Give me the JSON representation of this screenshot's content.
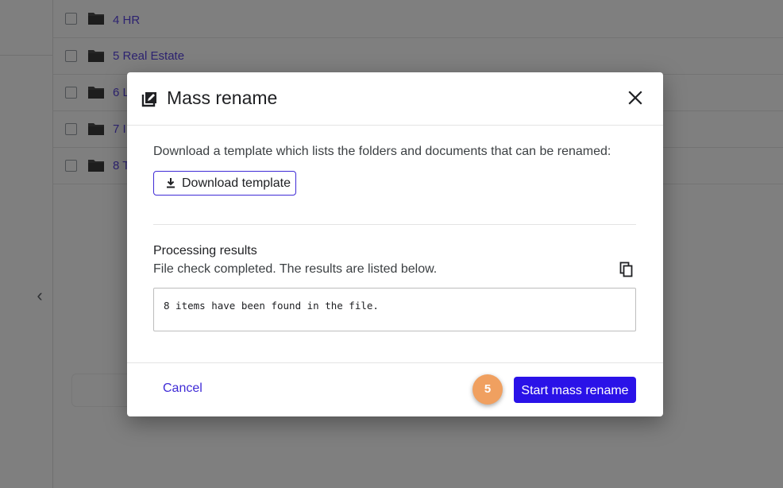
{
  "background": {
    "folders": [
      {
        "name": "4 HR"
      },
      {
        "name": "5 Real Estate"
      },
      {
        "name": "6 L"
      },
      {
        "name": "7 I"
      },
      {
        "name": "8 T"
      }
    ],
    "collapse_glyph": "‹"
  },
  "dialog": {
    "title": "Mass rename",
    "title_icon": "edit-note-icon",
    "close_icon": "close-icon",
    "intro": "Download a template which lists the folders and documents that can be renamed:",
    "download_label": "Download template",
    "download_icon": "download-icon",
    "results_title": "Processing results",
    "results_subtitle": "File check completed. The results are listed below.",
    "copy_icon": "copy-icon",
    "results_text": "8 items have been found in the file.",
    "cancel_label": "Cancel",
    "step_badge": "5",
    "primary_label": "Start mass rename"
  },
  "colors": {
    "accent": "#2a12e8",
    "link": "#3f2bd6",
    "badge": "#f0a060"
  }
}
